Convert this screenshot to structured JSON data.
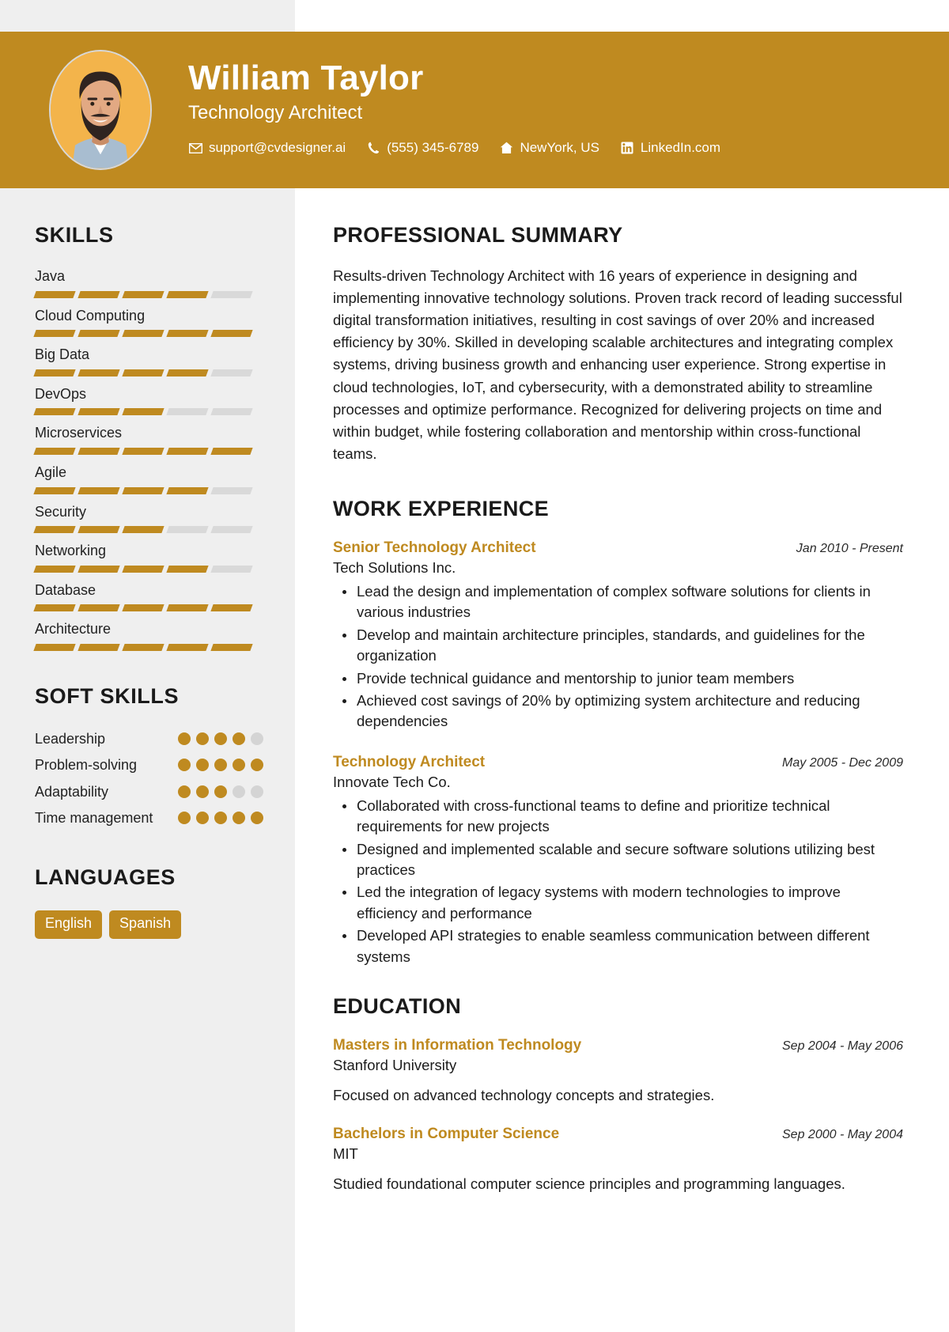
{
  "header": {
    "name": "William Taylor",
    "title": "Technology Architect",
    "contacts": [
      {
        "icon": "envelope-icon",
        "text": "support@cvdesigner.ai"
      },
      {
        "icon": "phone-icon",
        "text": "(555) 345-6789"
      },
      {
        "icon": "home-icon",
        "text": "NewYork, US"
      },
      {
        "icon": "linkedin-icon",
        "text": "LinkedIn.com"
      }
    ],
    "accent_color": "#bf8a20",
    "avatar_bg": "#f3b44b"
  },
  "sidebar": {
    "skills_heading": "SKILLS",
    "skills": [
      {
        "name": "Java",
        "level": 4,
        "max": 5
      },
      {
        "name": "Cloud Computing",
        "level": 5,
        "max": 5
      },
      {
        "name": "Big Data",
        "level": 4,
        "max": 5
      },
      {
        "name": "DevOps",
        "level": 3,
        "max": 5
      },
      {
        "name": "Microservices",
        "level": 5,
        "max": 5
      },
      {
        "name": "Agile",
        "level": 4,
        "max": 5
      },
      {
        "name": "Security",
        "level": 3,
        "max": 5
      },
      {
        "name": "Networking",
        "level": 4,
        "max": 5
      },
      {
        "name": "Database",
        "level": 5,
        "max": 5
      },
      {
        "name": "Architecture",
        "level": 5,
        "max": 5
      }
    ],
    "soft_skills_heading": "SOFT SKILLS",
    "soft_skills": [
      {
        "name": "Leadership",
        "level": 4,
        "max": 5
      },
      {
        "name": "Problem-solving",
        "level": 5,
        "max": 5
      },
      {
        "name": "Adaptability",
        "level": 3,
        "max": 5
      },
      {
        "name": "Time management",
        "level": 5,
        "max": 5
      }
    ],
    "languages_heading": "LANGUAGES",
    "languages": [
      "English",
      "Spanish"
    ]
  },
  "main": {
    "summary_heading": "PROFESSIONAL SUMMARY",
    "summary_text": "Results-driven Technology Architect with 16 years of experience in designing and implementing innovative technology solutions. Proven track record of leading successful digital transformation initiatives, resulting in cost savings of over 20% and increased efficiency by 30%. Skilled in developing scalable architectures and integrating complex systems, driving business growth and enhancing user experience. Strong expertise in cloud technologies, IoT, and cybersecurity, with a demonstrated ability to streamline processes and optimize performance. Recognized for delivering projects on time and within budget, while fostering collaboration and mentorship within cross-functional teams.",
    "experience_heading": "WORK EXPERIENCE",
    "experience": [
      {
        "role": "Senior Technology Architect",
        "date": "Jan 2010 - Present",
        "company": "Tech Solutions Inc.",
        "bullets": [
          "Lead the design and implementation of complex software solutions for clients in various industries",
          "Develop and maintain architecture principles, standards, and guidelines for the organization",
          "Provide technical guidance and mentorship to junior team members",
          "Achieved cost savings of 20% by optimizing system architecture and reducing dependencies"
        ]
      },
      {
        "role": "Technology Architect",
        "date": "May 2005 - Dec 2009",
        "company": "Innovate Tech Co.",
        "bullets": [
          "Collaborated with cross-functional teams to define and prioritize technical requirements for new projects",
          "Designed and implemented scalable and secure software solutions utilizing best practices",
          "Led the integration of legacy systems with modern technologies to improve efficiency and performance",
          "Developed API strategies to enable seamless communication between different systems"
        ]
      }
    ],
    "education_heading": "EDUCATION",
    "education": [
      {
        "degree": "Masters in Information Technology",
        "date": "Sep 2004 - May 2006",
        "school": "Stanford University",
        "description": "Focused on advanced technology concepts and strategies."
      },
      {
        "degree": "Bachelors in Computer Science",
        "date": "Sep 2000 - May 2004",
        "school": "MIT",
        "description": "Studied foundational computer science principles and programming languages."
      }
    ]
  }
}
